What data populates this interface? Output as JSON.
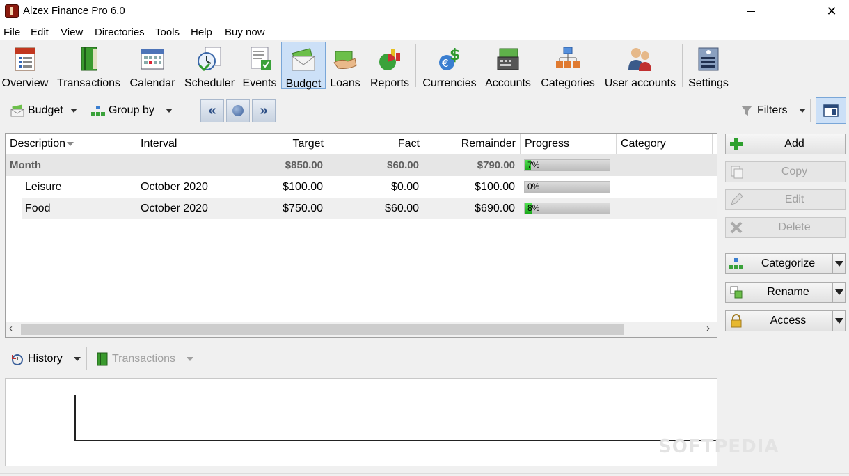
{
  "window": {
    "title": "Alzex Finance Pro 6.0",
    "min": "",
    "max": "",
    "close": "✕"
  },
  "menu": [
    "File",
    "Edit",
    "View",
    "Directories",
    "Tools",
    "Help",
    "Buy now"
  ],
  "toolbar": {
    "overview": "Overview",
    "transactions": "Transactions",
    "calendar": "Calendar",
    "scheduler": "Scheduler",
    "events": "Events",
    "budget": "Budget",
    "loans": "Loans",
    "reports": "Reports",
    "currencies": "Currencies",
    "accounts": "Accounts",
    "categories": "Categories",
    "user_accounts": "User accounts",
    "settings": "Settings",
    "active": "budget"
  },
  "subbar": {
    "budget": "Budget",
    "group_by": "Group by",
    "filters": "Filters"
  },
  "grid": {
    "columns": {
      "description": "Description",
      "interval": "Interval",
      "target": "Target",
      "fact": "Fact",
      "remainder": "Remainder",
      "progress": "Progress",
      "category": "Category"
    },
    "group": {
      "name": "Month",
      "target": "$850.00",
      "fact": "$60.00",
      "remainder": "$790.00",
      "progress_label": "7%",
      "progress": 0.07
    },
    "rows": [
      {
        "description": "Leisure",
        "interval": "October 2020",
        "target": "$100.00",
        "fact": "$0.00",
        "remainder": "$100.00",
        "progress_label": "0%",
        "progress": 0.0
      },
      {
        "description": "Food",
        "interval": "October 2020",
        "target": "$750.00",
        "fact": "$60.00",
        "remainder": "$690.00",
        "progress_label": "8%",
        "progress": 0.08
      }
    ]
  },
  "right_panel": {
    "add": "Add",
    "copy": "Copy",
    "edit": "Edit",
    "delete": "Delete",
    "categorize": "Categorize",
    "rename": "Rename",
    "access": "Access"
  },
  "bottom": {
    "history": "History",
    "transactions": "Transactions"
  },
  "watermark": "SOFTPEDIA",
  "colors": {
    "accent": "#cce0f7",
    "progress": "#22b022"
  }
}
